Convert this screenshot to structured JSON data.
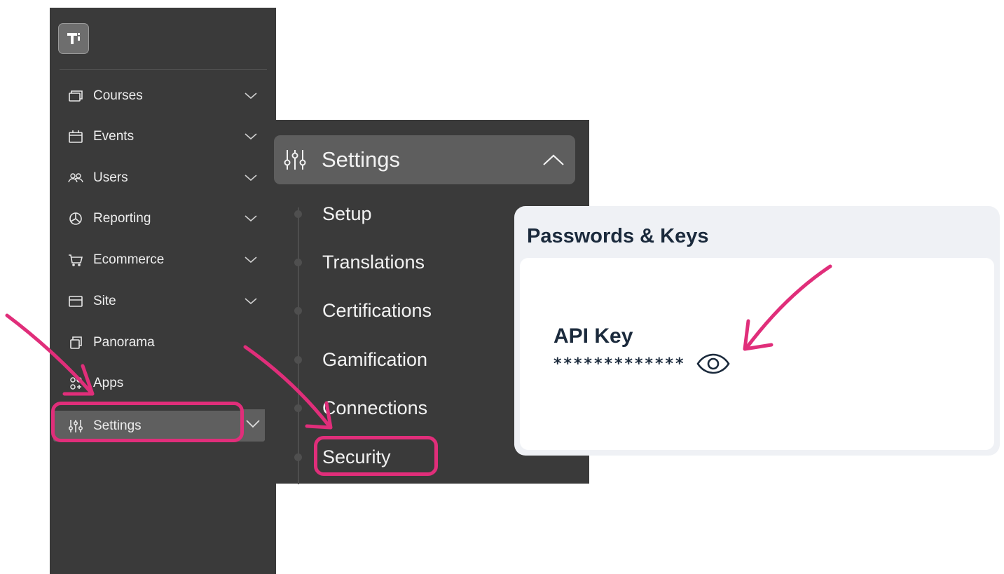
{
  "sidebar": {
    "logo_icon": "brand-logo-icon",
    "items": [
      {
        "label": "Courses",
        "icon": "courses-icon",
        "chevron": "chevron-down-icon"
      },
      {
        "label": "Events",
        "icon": "calendar-icon",
        "chevron": "chevron-down-icon"
      },
      {
        "label": "Users",
        "icon": "users-icon",
        "chevron": "chevron-down-icon"
      },
      {
        "label": "Reporting",
        "icon": "pie-chart-icon",
        "chevron": "chevron-down-icon"
      },
      {
        "label": "Ecommerce",
        "icon": "cart-icon",
        "chevron": "chevron-down-icon"
      },
      {
        "label": "Site",
        "icon": "site-icon",
        "chevron": "chevron-down-icon"
      },
      {
        "label": "Panorama",
        "icon": "panorama-icon"
      },
      {
        "label": "Apps",
        "icon": "apps-icon"
      },
      {
        "label": "Settings",
        "icon": "sliders-icon",
        "chevron": "chevron-down-icon",
        "active": true
      }
    ]
  },
  "submenu": {
    "title": "Settings",
    "icon": "sliders-icon",
    "chevron": "chevron-up-icon",
    "items": [
      {
        "label": "Setup"
      },
      {
        "label": "Translations"
      },
      {
        "label": "Certifications"
      },
      {
        "label": "Gamification"
      },
      {
        "label": "Connections"
      },
      {
        "label": "Security",
        "highlighted": true
      }
    ]
  },
  "card": {
    "title": "Passwords & Keys",
    "api_key_label": "API Key",
    "api_key_value": "*************",
    "reveal_icon": "eye-icon"
  },
  "annotations": {
    "highlight_color": "#e02e7a"
  },
  "colors": {
    "sidebar_bg": "#3a3a3a",
    "active_bg": "#5f5f5f",
    "card_bg": "#eff1f5",
    "text_dark": "#1b2a3c"
  }
}
